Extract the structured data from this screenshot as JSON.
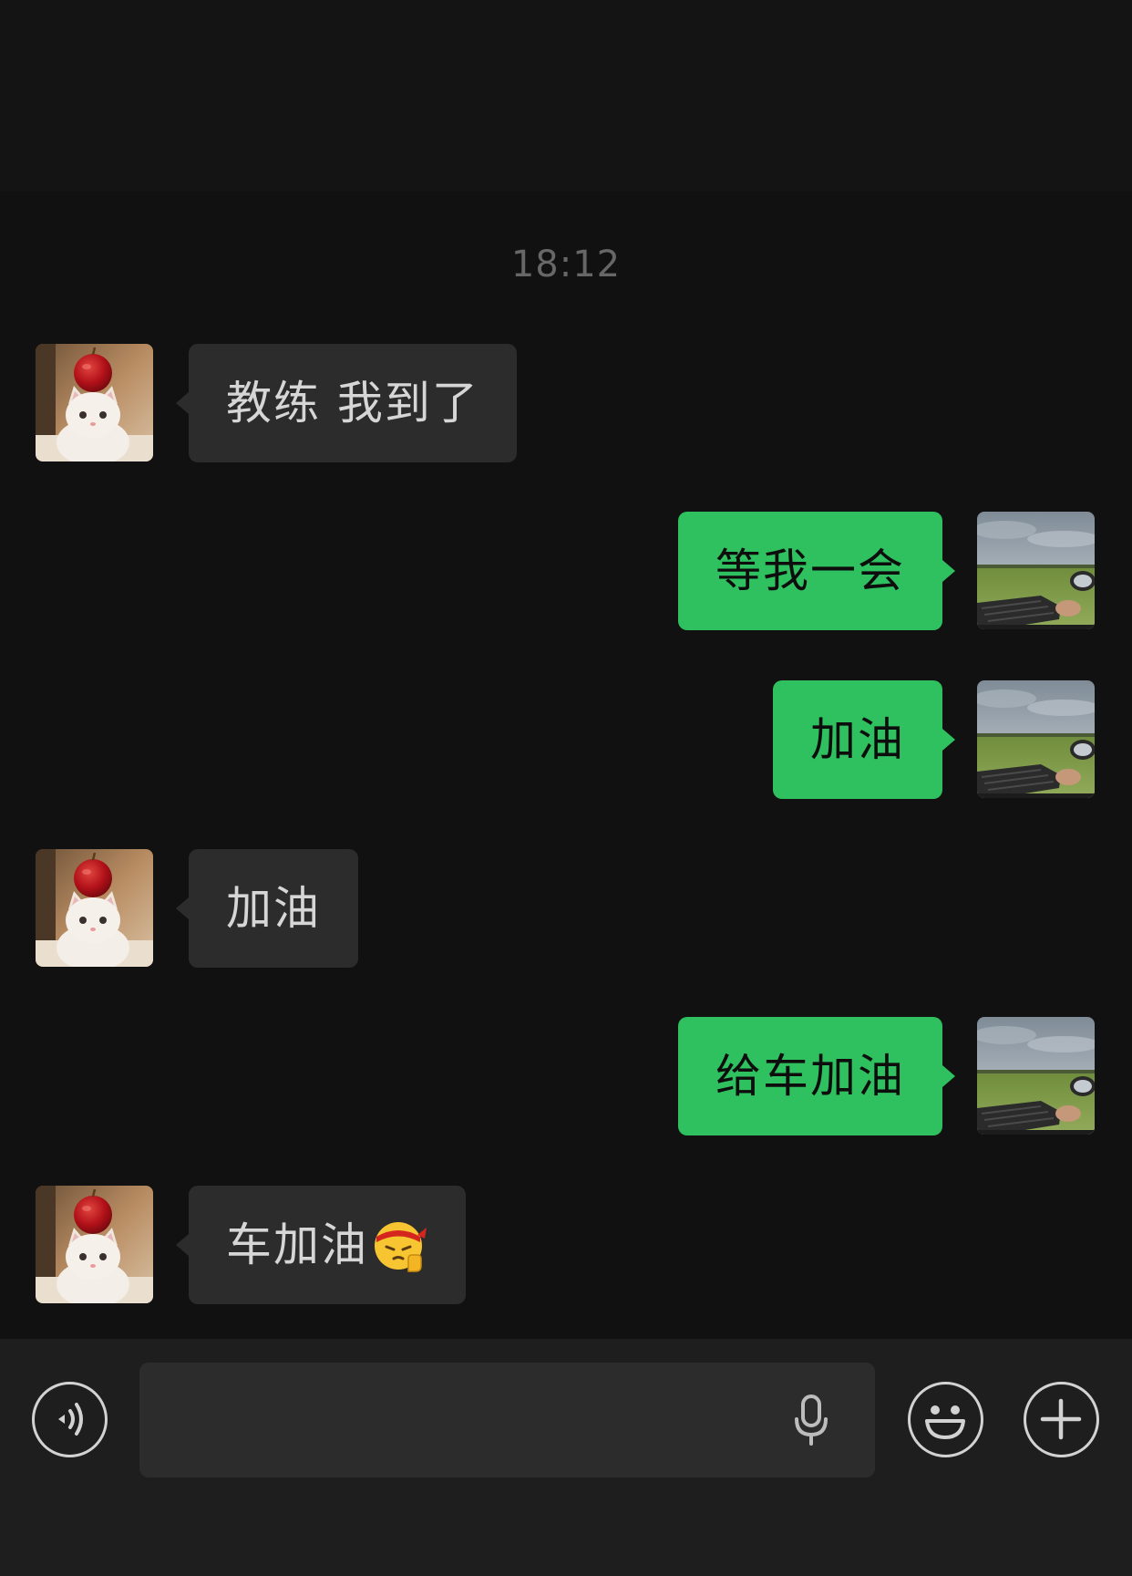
{
  "chat": {
    "timestamp": "18:12",
    "messages": [
      {
        "outgoing": false,
        "text": "教练 我到了"
      },
      {
        "outgoing": true,
        "text": "等我一会"
      },
      {
        "outgoing": true,
        "text": "加油"
      },
      {
        "outgoing": false,
        "text": "加油"
      },
      {
        "outgoing": true,
        "text": "给车加油"
      },
      {
        "outgoing": false,
        "text": "车加油",
        "emoji_icon": "fighting-emoji-icon"
      }
    ],
    "icons": {
      "incoming_avatar": "cat-with-apple-avatar-icon",
      "outgoing_avatar": "landscape-driving-avatar-icon"
    }
  },
  "input_bar": {
    "text_value": "",
    "icons": {
      "voice": "voice-mode-icon",
      "mic": "microphone-icon",
      "emoji": "smiley-emoji-icon",
      "more": "plus-icon"
    }
  },
  "colors": {
    "background": "#111111",
    "incoming_bubble": "#2c2c2c",
    "outgoing_bubble": "#2fc15f",
    "input_bar": "#1e1e1e",
    "timestamp": "#676767"
  }
}
